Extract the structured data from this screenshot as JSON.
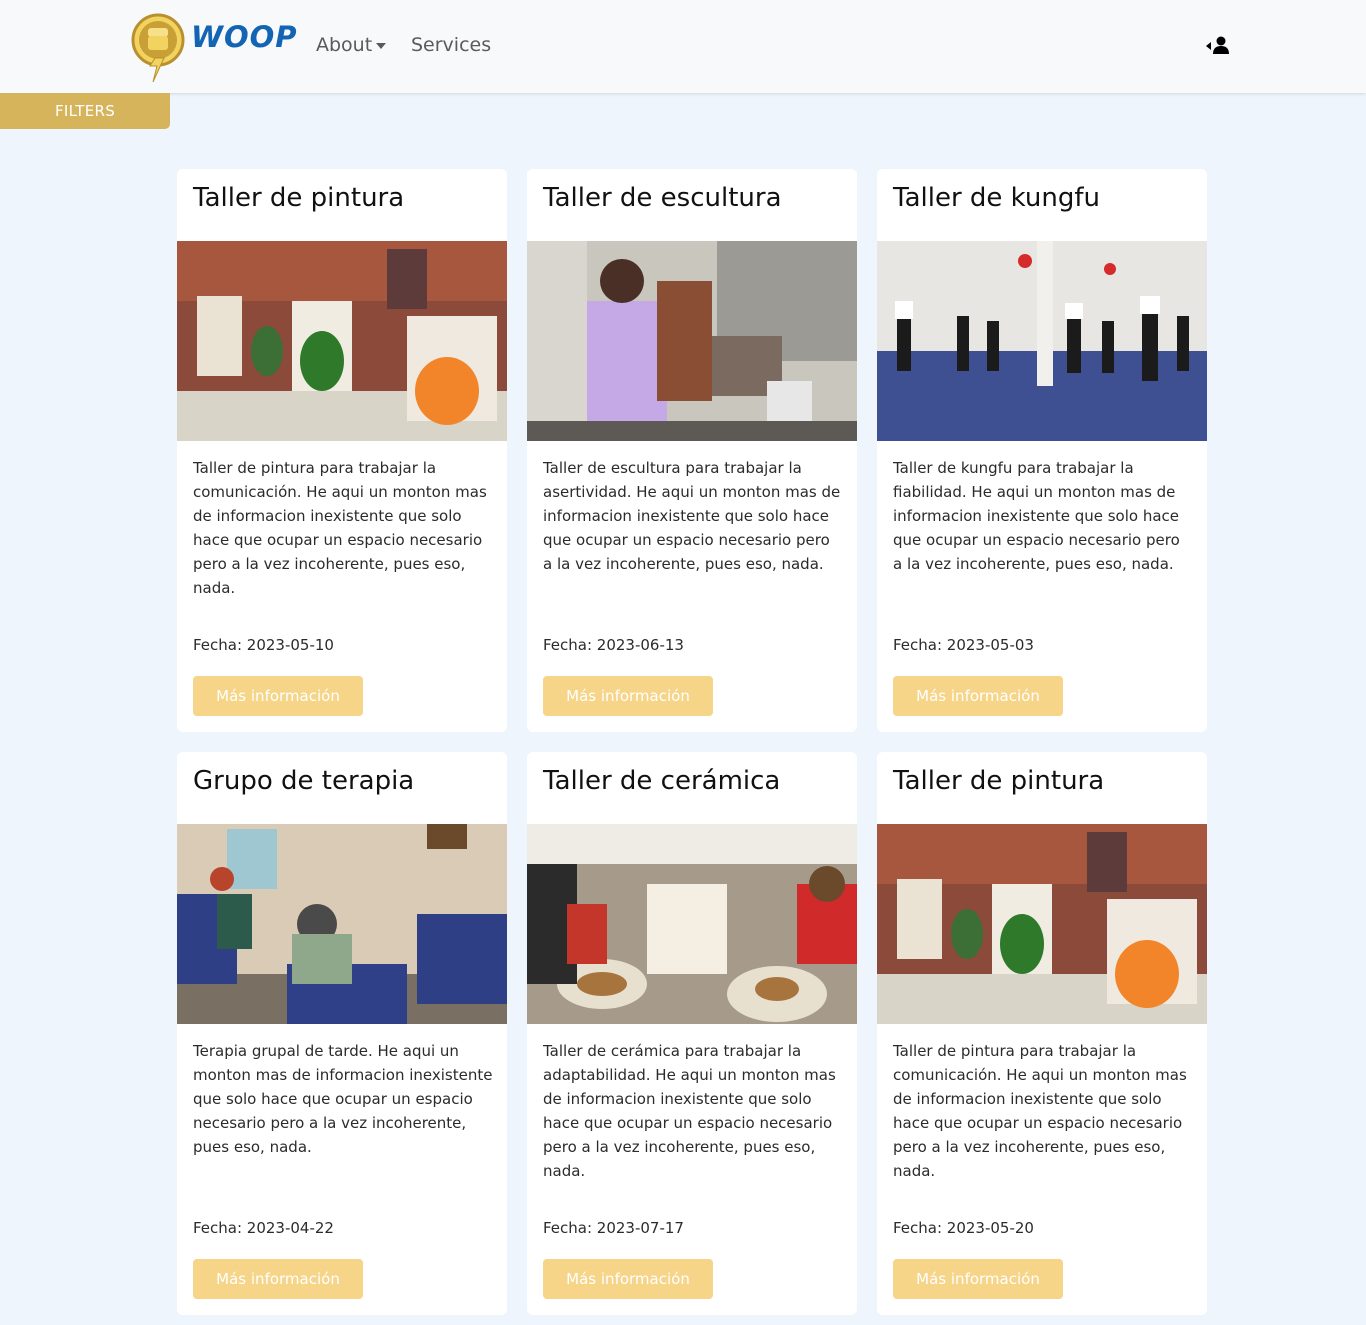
{
  "navbar": {
    "brand": "WOOP",
    "about_label": "About",
    "services_label": "Services"
  },
  "filters": {
    "label": "FILTERS"
  },
  "colors": {
    "brand_blue": "#1464b4",
    "brand_gold": "#d6b45c",
    "button_yellow": "#f6d488",
    "page_background": "#eef5fc"
  },
  "cards": [
    {
      "title": "Taller de pintura",
      "description": "Taller de pintura para trabajar la comunicación. He aqui un monton mas de informacion inexistente que solo hace que ocupar un espacio necesario pero a la vez incoherente, pues eso, nada.",
      "date": "Fecha: 2023-05-10",
      "button_label": "Más información",
      "image": "painting-workshop-photo"
    },
    {
      "title": "Taller de escultura",
      "description": "Taller de escultura para trabajar la asertividad. He aqui un monton mas de informacion inexistente que solo hace que ocupar un espacio necesario pero a la vez incoherente, pues eso, nada.",
      "date": "Fecha: 2023-06-13",
      "button_label": "Más información",
      "image": "sculpture-workshop-photo"
    },
    {
      "title": "Taller de kungfu",
      "description": "Taller de kungfu para trabajar la fiabilidad. He aqui un monton mas de informacion inexistente que solo hace que ocupar un espacio necesario pero a la vez incoherente, pues eso, nada.",
      "date": "Fecha: 2023-05-03",
      "button_label": "Más información",
      "image": "kungfu-class-photo"
    },
    {
      "title": "Grupo de terapia",
      "description": "Terapia grupal de tarde. He aqui un monton mas de informacion inexistente que solo hace que ocupar un espacio necesario pero a la vez incoherente, pues eso, nada.",
      "date": "Fecha: 2023-04-22",
      "button_label": "Más información",
      "image": "therapy-group-photo"
    },
    {
      "title": "Taller de cerámica",
      "description": "Taller de cerámica para trabajar la adaptabilidad. He aqui un monton mas de informacion inexistente que solo hace que ocupar un espacio necesario pero a la vez incoherente, pues eso, nada.",
      "date": "Fecha: 2023-07-17",
      "button_label": "Más información",
      "image": "ceramics-workshop-photo"
    },
    {
      "title": "Taller de pintura",
      "description": "Taller de pintura para trabajar la comunicación. He aqui un monton mas de informacion inexistente que solo hace que ocupar un espacio necesario pero a la vez incoherente, pues eso, nada.",
      "date": "Fecha: 2023-05-20",
      "button_label": "Más información",
      "image": "painting-workshop-photo"
    }
  ]
}
